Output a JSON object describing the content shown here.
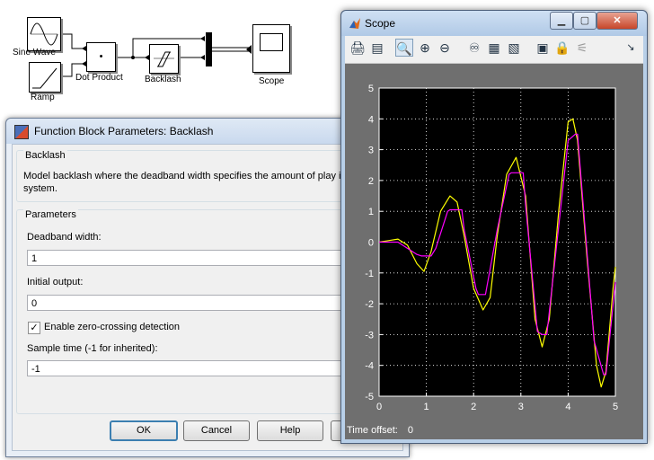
{
  "diagram": {
    "blocks": {
      "sine_wave": "Sine Wave",
      "ramp": "Ramp",
      "dot_product": "Dot Product",
      "dot_product_symbol": "•",
      "backlash": "Backlash",
      "scope": "Scope"
    }
  },
  "dialog": {
    "title": "Function Block Parameters: Backlash",
    "block_name": "Backlash",
    "description": "Model backlash where the deadband width specifies the amount of play in the system.",
    "parameters_heading": "Parameters",
    "deadband_label": "Deadband width:",
    "deadband_value": "1",
    "initial_output_label": "Initial output:",
    "initial_output_value": "0",
    "zero_crossing_label": "Enable zero-crossing detection",
    "zero_crossing_checked": "✓",
    "sample_time_label": "Sample time (-1 for inherited):",
    "sample_time_value": "-1",
    "buttons": {
      "ok": "OK",
      "cancel": "Cancel",
      "help": "Help"
    }
  },
  "scope": {
    "title": "Scope",
    "window_buttons": {
      "minimize": "▁",
      "maximize": "▢",
      "close": "✕"
    },
    "toolbar": {
      "print": "🖨",
      "params": "▤",
      "zoom": "🔍",
      "zoom_x": "⊕",
      "zoom_y": "⊖",
      "autoscale": "♾",
      "save_axes": "▦",
      "restore_axes": "▧",
      "floating_scope": "▣",
      "lock_axes": "🔒",
      "signal_selection": "⚟",
      "menu_arrow": "↘"
    },
    "time_offset_label": "Time offset:",
    "time_offset_value": "0"
  },
  "colors": {
    "plot_bg": "#000000",
    "grid": "#ffffff",
    "series_input": "#ffff00",
    "series_output": "#ff00ff"
  },
  "chart_data": {
    "type": "line",
    "xlim": [
      0,
      5
    ],
    "ylim": [
      -5,
      5
    ],
    "x_ticks": [
      "0",
      "1",
      "2",
      "3",
      "4",
      "5"
    ],
    "y_ticks": [
      "5",
      "4",
      "3",
      "2",
      "1",
      "0",
      "-1",
      "-2",
      "-3",
      "-4",
      "-5"
    ],
    "grid": true,
    "series": [
      {
        "color": "#ffff00",
        "x": [
          0,
          0.2,
          0.4,
          0.6,
          0.8,
          0.95,
          1.1,
          1.3,
          1.5,
          1.65,
          1.8,
          2.0,
          2.2,
          2.35,
          2.5,
          2.7,
          2.9,
          3.1,
          3.3,
          3.45,
          3.6,
          3.8,
          4.0,
          4.1,
          4.2,
          4.4,
          4.6,
          4.7,
          4.8,
          4.95,
          5.0
        ],
        "y": [
          0,
          0.05,
          0.1,
          -0.1,
          -0.7,
          -0.95,
          -0.3,
          1.0,
          1.5,
          1.3,
          0.2,
          -1.5,
          -2.2,
          -1.8,
          0.2,
          2.2,
          2.75,
          1.5,
          -2.5,
          -3.4,
          -2.5,
          1.0,
          3.9,
          4.0,
          3.3,
          -0.5,
          -4.0,
          -4.7,
          -4.2,
          -1.5,
          -0.8
        ]
      },
      {
        "color": "#ff00ff",
        "x": [
          0,
          0.4,
          0.8,
          0.9,
          1.1,
          1.2,
          1.45,
          1.5,
          1.75,
          1.8,
          2.05,
          2.1,
          2.25,
          2.5,
          2.75,
          2.8,
          3.05,
          3.1,
          3.35,
          3.45,
          3.55,
          4.0,
          4.15,
          4.2,
          4.55,
          4.75,
          4.8,
          5.0
        ],
        "y": [
          0,
          0,
          -0.4,
          -0.45,
          -0.45,
          -0.2,
          1.0,
          1.05,
          1.05,
          0.4,
          -1.5,
          -1.7,
          -1.7,
          0.4,
          2.2,
          2.25,
          2.25,
          1.2,
          -2.9,
          -3.0,
          -3.0,
          3.3,
          3.5,
          3.5,
          -3.2,
          -4.3,
          -4.3,
          -1.3
        ]
      }
    ]
  }
}
